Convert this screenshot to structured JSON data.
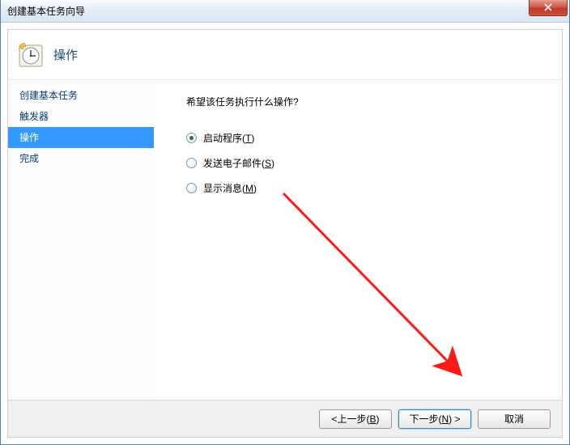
{
  "window": {
    "title": "创建基本任务向导"
  },
  "header": {
    "title": "操作"
  },
  "sidebar": {
    "items": [
      {
        "label": "创建基本任务",
        "active": false
      },
      {
        "label": "触发器",
        "active": false
      },
      {
        "label": "操作",
        "active": true
      },
      {
        "label": "完成",
        "active": false
      }
    ]
  },
  "main": {
    "prompt": "希望该任务执行什么操作?",
    "options": [
      {
        "label": "启动程序(T)",
        "checked": true
      },
      {
        "label": "发送电子邮件(S)",
        "checked": false
      },
      {
        "label": "显示消息(M)",
        "checked": false
      }
    ]
  },
  "footer": {
    "back": "<上一步(B)",
    "next": "下一步(N) >",
    "cancel": "取消"
  }
}
